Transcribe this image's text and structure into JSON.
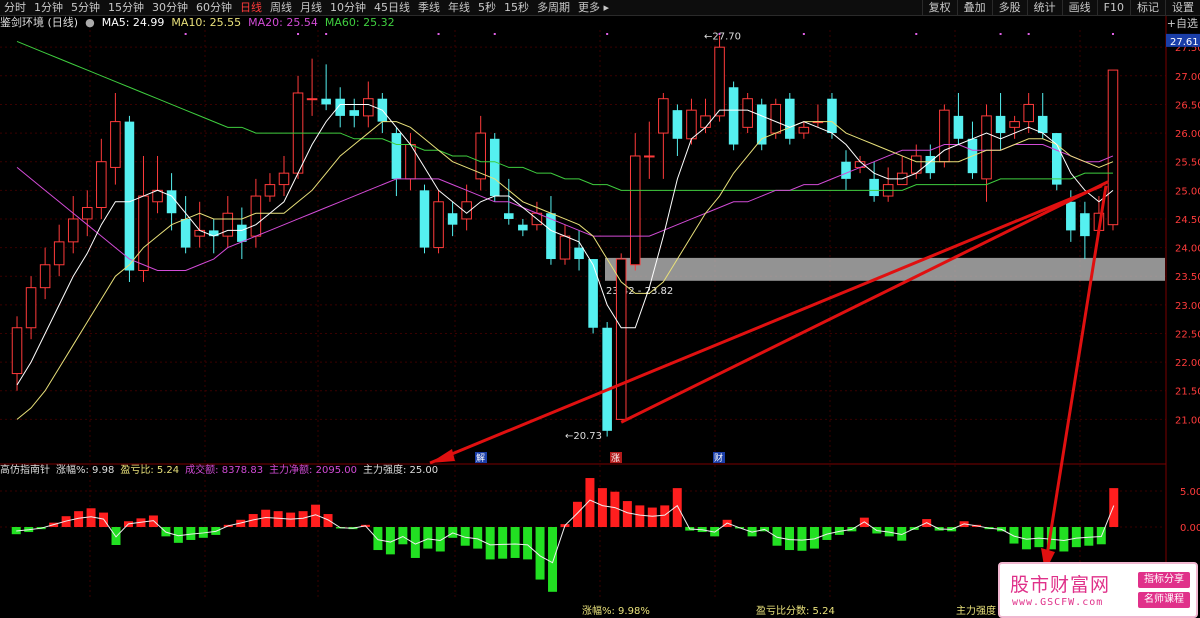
{
  "toolbar": {
    "periods": [
      "分时",
      "1分钟",
      "5分钟",
      "15分钟",
      "30分钟",
      "60分钟",
      "日线",
      "周线",
      "月线",
      "10分钟",
      "45日线",
      "季线",
      "年线",
      "5秒",
      "15秒",
      "多周期",
      "更多 ▸"
    ],
    "active": "日线",
    "right": [
      "复权",
      "叠加",
      "多股",
      "统计",
      "画线",
      "F10",
      "标记",
      "设置"
    ]
  },
  "legend": {
    "title": "鉴剑环境 (日线)",
    "ma5": "MA5: 24.99",
    "ma10": "MA10: 25.55",
    "ma20": "MA20: 25.54",
    "ma60": "MA60: 25.32"
  },
  "side": {
    "add_label": "+自选"
  },
  "price_axis": {
    "ticks": [
      "27.50",
      "27.00",
      "26.50",
      "26.00",
      "25.50",
      "25.00",
      "24.50",
      "24.00",
      "23.50",
      "23.00",
      "22.50",
      "22.00",
      "21.50",
      "21.00"
    ],
    "current": "27.61"
  },
  "annotations": {
    "high": "27.70",
    "low": "20.73",
    "zone": "23.42 - 23.82"
  },
  "markers": [
    "解",
    "涨",
    "财"
  ],
  "indicator": {
    "title": "高仿指南针",
    "change": "涨幅%: 9.98",
    "pl_ratio": "盈亏比: 5.24",
    "volume": "成交额: 8378.83",
    "net_inflow": "主力净额: 2095.00",
    "strength": "主力强度: 25.00",
    "ticks": [
      "5.00",
      "0.00"
    ]
  },
  "footer": {
    "change": "涨幅%: 9.98%",
    "score": "盈亏比分数: 5.24",
    "strength": "主力强度"
  },
  "watermark": {
    "name": "股市财富网",
    "url": "www.GSCFW.com",
    "tag1": "指标分享",
    "tag2": "名师课程"
  },
  "colors": {
    "up": "#ff3b3b",
    "down": "#55f0f0",
    "ma5": "#ffffff",
    "ma10": "#e8e07a",
    "ma20": "#d24bd6",
    "ma60": "#3fce3f",
    "bar_up": "#ff1e1e",
    "bar_down": "#22e022",
    "arrow": "#e01010"
  },
  "chart_data": {
    "type": "candlestick",
    "ylim": [
      20.5,
      27.8
    ],
    "candles": [
      [
        21.8,
        22.6,
        21.5,
        22.8
      ],
      [
        22.6,
        23.3,
        22.4,
        23.5
      ],
      [
        23.3,
        23.7,
        23.1,
        24.0
      ],
      [
        23.7,
        24.1,
        23.5,
        24.4
      ],
      [
        24.1,
        24.5,
        23.9,
        24.9
      ],
      [
        24.5,
        24.7,
        24.2,
        25.0
      ],
      [
        24.7,
        25.5,
        24.5,
        25.9
      ],
      [
        25.4,
        26.2,
        25.1,
        26.7
      ],
      [
        26.2,
        23.6,
        23.4,
        26.3
      ],
      [
        23.6,
        24.9,
        23.4,
        25.6
      ],
      [
        24.8,
        25.0,
        24.6,
        25.6
      ],
      [
        25.0,
        24.6,
        24.3,
        25.3
      ],
      [
        24.5,
        24.0,
        23.9,
        24.9
      ],
      [
        24.2,
        24.3,
        24.0,
        24.8
      ],
      [
        24.3,
        24.2,
        23.9,
        24.5
      ],
      [
        24.2,
        24.6,
        24.0,
        24.9
      ],
      [
        24.4,
        24.1,
        23.8,
        24.7
      ],
      [
        24.2,
        24.9,
        24.0,
        25.2
      ],
      [
        24.9,
        25.1,
        24.8,
        25.3
      ],
      [
        25.1,
        25.3,
        24.9,
        25.6
      ],
      [
        25.3,
        26.7,
        25.2,
        27.0
      ],
      [
        26.6,
        26.6,
        26.3,
        27.3
      ],
      [
        26.6,
        26.5,
        26.4,
        27.2
      ],
      [
        26.6,
        26.3,
        26.1,
        26.8
      ],
      [
        26.4,
        26.3,
        26.1,
        26.6
      ],
      [
        26.3,
        26.6,
        26.1,
        26.9
      ],
      [
        26.6,
        26.2,
        26.0,
        26.7
      ],
      [
        26.0,
        25.2,
        24.9,
        26.1
      ],
      [
        25.2,
        25.8,
        25.0,
        26.0
      ],
      [
        25.0,
        24.0,
        23.9,
        25.1
      ],
      [
        24.0,
        24.8,
        23.9,
        25.0
      ],
      [
        24.6,
        24.4,
        24.2,
        24.8
      ],
      [
        24.5,
        24.8,
        24.3,
        25.1
      ],
      [
        25.2,
        26.0,
        25.0,
        26.3
      ],
      [
        25.9,
        24.9,
        24.8,
        26.0
      ],
      [
        24.6,
        24.5,
        24.4,
        25.2
      ],
      [
        24.4,
        24.3,
        24.2,
        24.5
      ],
      [
        24.4,
        24.6,
        24.3,
        24.8
      ],
      [
        24.6,
        23.8,
        23.7,
        24.9
      ],
      [
        23.8,
        24.2,
        23.7,
        24.4
      ],
      [
        24.0,
        23.8,
        23.6,
        24.3
      ],
      [
        23.8,
        22.6,
        22.5,
        23.8
      ],
      [
        22.6,
        20.8,
        20.7,
        22.7
      ],
      [
        21.0,
        23.8,
        21.0,
        23.9
      ],
      [
        23.7,
        25.6,
        23.6,
        26.0
      ],
      [
        25.6,
        25.6,
        25.2,
        26.2
      ],
      [
        26.0,
        26.6,
        25.2,
        26.7
      ],
      [
        26.4,
        25.9,
        25.6,
        26.5
      ],
      [
        25.9,
        26.4,
        25.8,
        26.6
      ],
      [
        26.1,
        26.3,
        26.0,
        26.6
      ],
      [
        26.3,
        27.5,
        26.2,
        27.7
      ],
      [
        26.8,
        25.8,
        25.7,
        26.9
      ],
      [
        26.1,
        26.6,
        26.0,
        26.7
      ],
      [
        26.5,
        25.8,
        25.7,
        26.6
      ],
      [
        26.0,
        26.5,
        25.9,
        26.6
      ],
      [
        26.6,
        25.9,
        25.8,
        26.7
      ],
      [
        26.0,
        26.1,
        25.9,
        26.2
      ],
      [
        26.2,
        26.2,
        26.1,
        26.5
      ],
      [
        26.6,
        26.0,
        25.9,
        26.7
      ],
      [
        25.5,
        25.2,
        25.0,
        25.7
      ],
      [
        25.4,
        25.5,
        25.3,
        25.6
      ],
      [
        25.2,
        24.9,
        24.8,
        25.5
      ],
      [
        24.9,
        25.1,
        24.8,
        25.4
      ],
      [
        25.1,
        25.3,
        25.1,
        25.6
      ],
      [
        25.3,
        25.6,
        25.2,
        25.8
      ],
      [
        25.6,
        25.3,
        25.2,
        25.8
      ],
      [
        25.5,
        26.4,
        25.4,
        26.5
      ],
      [
        26.3,
        25.9,
        25.8,
        26.7
      ],
      [
        25.9,
        25.3,
        25.2,
        26.2
      ],
      [
        25.2,
        26.3,
        24.8,
        26.5
      ],
      [
        26.3,
        26.0,
        25.7,
        26.7
      ],
      [
        26.1,
        26.2,
        25.9,
        26.3
      ],
      [
        26.2,
        26.5,
        26.0,
        26.7
      ],
      [
        26.3,
        26.0,
        25.9,
        26.7
      ],
      [
        26.0,
        25.1,
        25.0,
        26.0
      ],
      [
        24.8,
        24.3,
        24.1,
        25.0
      ],
      [
        24.6,
        24.2,
        23.8,
        24.8
      ],
      [
        24.3,
        24.6,
        24.2,
        24.9
      ],
      [
        24.4,
        27.1,
        24.3,
        27.1
      ]
    ],
    "ma": {
      "MA5": [
        21.6,
        22.0,
        22.5,
        23.0,
        23.5,
        23.9,
        24.4,
        24.8,
        24.8,
        24.9,
        25.0,
        24.9,
        24.6,
        24.3,
        24.2,
        24.3,
        24.3,
        24.4,
        24.6,
        24.8,
        25.3,
        25.8,
        26.2,
        26.5,
        26.5,
        26.5,
        26.4,
        26.1,
        25.8,
        25.4,
        25.0,
        24.8,
        24.6,
        24.8,
        24.9,
        24.9,
        24.7,
        24.5,
        24.3,
        24.2,
        24.1,
        23.7,
        23.0,
        22.6,
        22.6,
        23.3,
        24.2,
        25.2,
        25.9,
        26.1,
        26.4,
        26.4,
        26.4,
        26.3,
        26.2,
        26.1,
        26.2,
        26.1,
        26.0,
        25.8,
        25.5,
        25.3,
        25.2,
        25.2,
        25.3,
        25.5,
        25.7,
        25.8,
        25.9,
        26.0,
        25.9,
        26.0,
        26.1,
        26.0,
        25.8,
        25.3,
        25.0,
        24.8,
        25.0
      ],
      "MA10": [
        21.0,
        21.2,
        21.5,
        21.9,
        22.3,
        22.7,
        23.1,
        23.5,
        23.7,
        24.0,
        24.2,
        24.4,
        24.5,
        24.6,
        24.5,
        24.5,
        24.5,
        24.6,
        24.6,
        24.6,
        24.8,
        25.0,
        25.3,
        25.6,
        25.8,
        26.0,
        26.2,
        26.2,
        26.1,
        25.9,
        25.7,
        25.5,
        25.4,
        25.3,
        25.2,
        25.0,
        24.8,
        24.7,
        24.6,
        24.5,
        24.4,
        24.2,
        23.8,
        23.4,
        23.2,
        23.2,
        23.4,
        23.8,
        24.2,
        24.6,
        24.9,
        25.3,
        25.6,
        25.9,
        26.0,
        26.1,
        26.2,
        26.2,
        26.2,
        26.0,
        25.9,
        25.8,
        25.7,
        25.6,
        25.5,
        25.5,
        25.5,
        25.5,
        25.6,
        25.7,
        25.7,
        25.8,
        25.9,
        25.9,
        25.8,
        25.6,
        25.5,
        25.4,
        25.5
      ],
      "MA20": [
        25.4,
        25.2,
        25.0,
        24.8,
        24.6,
        24.4,
        24.2,
        24.0,
        23.8,
        23.7,
        23.6,
        23.6,
        23.6,
        23.7,
        23.8,
        24.0,
        24.1,
        24.2,
        24.3,
        24.4,
        24.5,
        24.6,
        24.7,
        24.8,
        24.9,
        25.0,
        25.1,
        25.2,
        25.2,
        25.2,
        25.2,
        25.1,
        25.0,
        24.9,
        24.8,
        24.8,
        24.7,
        24.6,
        24.5,
        24.4,
        24.3,
        24.2,
        24.2,
        24.2,
        24.2,
        24.2,
        24.3,
        24.4,
        24.5,
        24.6,
        24.7,
        24.8,
        24.8,
        24.9,
        25.0,
        25.0,
        25.1,
        25.1,
        25.2,
        25.3,
        25.4,
        25.5,
        25.6,
        25.7,
        25.7,
        25.7,
        25.8,
        25.8,
        25.7,
        25.7,
        25.7,
        25.8,
        25.8,
        25.8,
        25.7,
        25.6,
        25.5,
        25.5,
        25.6
      ],
      "MA60": [
        27.6,
        27.5,
        27.4,
        27.3,
        27.2,
        27.1,
        27.0,
        26.9,
        26.8,
        26.7,
        26.6,
        26.5,
        26.4,
        26.3,
        26.2,
        26.1,
        26.1,
        26.0,
        26.0,
        26.0,
        26.0,
        26.0,
        26.0,
        26.0,
        25.9,
        25.9,
        25.9,
        25.8,
        25.8,
        25.7,
        25.7,
        25.6,
        25.6,
        25.5,
        25.5,
        25.4,
        25.4,
        25.3,
        25.3,
        25.2,
        25.2,
        25.1,
        25.1,
        25.0,
        25.0,
        25.0,
        25.0,
        25.0,
        25.0,
        25.0,
        25.0,
        25.0,
        25.0,
        25.0,
        25.0,
        25.0,
        25.0,
        25.0,
        25.0,
        25.0,
        25.0,
        25.0,
        25.0,
        25.0,
        25.1,
        25.1,
        25.1,
        25.1,
        25.1,
        25.1,
        25.2,
        25.2,
        25.2,
        25.2,
        25.2,
        25.2,
        25.3,
        25.3,
        25.3
      ]
    },
    "indicator_values": [
      -1,
      -0.7,
      -0.3,
      0.6,
      1.5,
      2.2,
      2.6,
      2.0,
      -2.5,
      0.8,
      1.2,
      1.6,
      -1.3,
      -2.2,
      -1.8,
      -1.5,
      -1.1,
      0.3,
      1.0,
      1.8,
      2.4,
      2.2,
      2.0,
      2.2,
      3.1,
      1.8,
      -0.2,
      -0.3,
      0.3,
      -3.2,
      -3.8,
      -2.4,
      -4.3,
      -3.0,
      -3.4,
      -1.5,
      -2.6,
      -3.0,
      -4.5,
      -4.4,
      -4.3,
      -4.5,
      -7.3,
      -9.0,
      0.4,
      3.5,
      6.8,
      5.4,
      4.9,
      3.6,
      3.0,
      2.7,
      3.0,
      5.4,
      -0.5,
      -0.7,
      -1.3,
      1.0,
      -0.2,
      -1.3,
      -0.6,
      -2.6,
      -3.2,
      -3.3,
      -3.0,
      -1.8,
      -1.1,
      -0.6,
      1.3,
      -0.9,
      -1.3,
      -1.9,
      -0.4,
      1.1,
      -0.5,
      -0.6,
      0.8,
      0.3,
      -0.3,
      -0.6,
      -2.3,
      -3.1,
      -2.8,
      -3.1,
      -3.4,
      -2.8,
      -2.6,
      -2.4,
      5.4
    ]
  }
}
